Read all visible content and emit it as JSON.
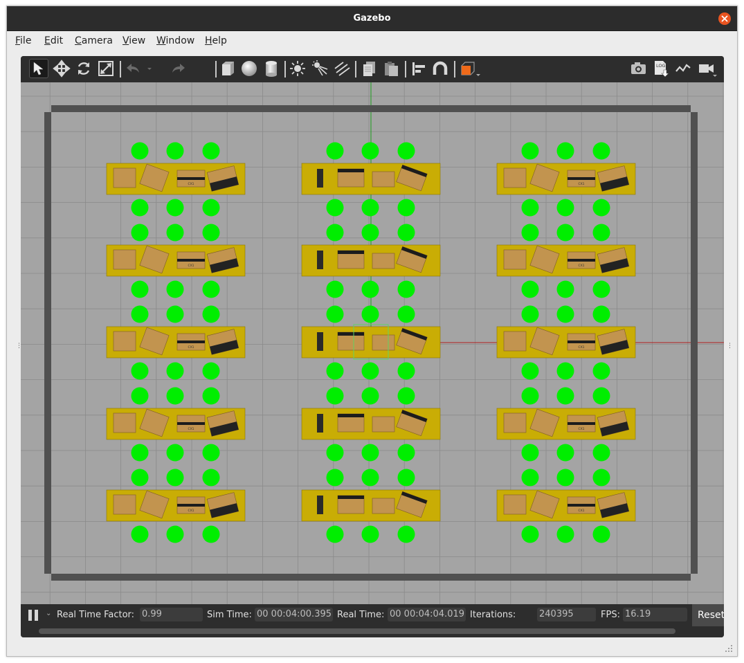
{
  "window": {
    "title": "Gazebo"
  },
  "menu": [
    {
      "label": "File",
      "accel": "F",
      "rest": "ile"
    },
    {
      "label": "Edit",
      "accel": "E",
      "rest": "dit"
    },
    {
      "label": "Camera",
      "accel": "C",
      "rest": "amera"
    },
    {
      "label": "View",
      "accel": "V",
      "rest": "iew"
    },
    {
      "label": "Window",
      "accel": "W",
      "rest": "indow"
    },
    {
      "label": "Help",
      "accel": "H",
      "rest": "elp"
    }
  ],
  "toolbar": {
    "tools": [
      "select-mode-icon",
      "translate-mode-icon",
      "rotate-mode-icon",
      "scale-mode-icon",
      "undo-icon",
      "redo-icon",
      "box-shape-icon",
      "sphere-shape-icon",
      "cylinder-shape-icon",
      "point-light-icon",
      "spot-light-icon",
      "directional-light-icon",
      "copy-icon",
      "paste-icon",
      "align-icon",
      "snap-icon",
      "view-angle-icon",
      "screenshot-icon",
      "log-icon",
      "plot-icon",
      "video-record-icon"
    ],
    "active_tool": "select-mode-icon",
    "log_icon_text": "LOG"
  },
  "scene": {
    "ground_color": "#a4a4a4",
    "grid_color": "#8a8a8a",
    "wall_color": "#505050",
    "shelf_color": "#c9ad05",
    "marker_color": "#00ee00",
    "box_color": "#c2944f",
    "shelf_columns": 3,
    "shelf_rows": 5,
    "markers_per_group": 3,
    "box_label": "CX1"
  },
  "status": {
    "real_time_factor_label": "Real Time Factor:",
    "real_time_factor": "0.99",
    "sim_time_label": "Sim Time:",
    "sim_time": "00 00:04:00.395",
    "real_time_label": "Real Time:",
    "real_time": "00 00:04:04.019",
    "iterations_label": "Iterations:",
    "iterations": "240395",
    "fps_label": "FPS:",
    "fps": "16.19",
    "reset_label": "Reset"
  }
}
